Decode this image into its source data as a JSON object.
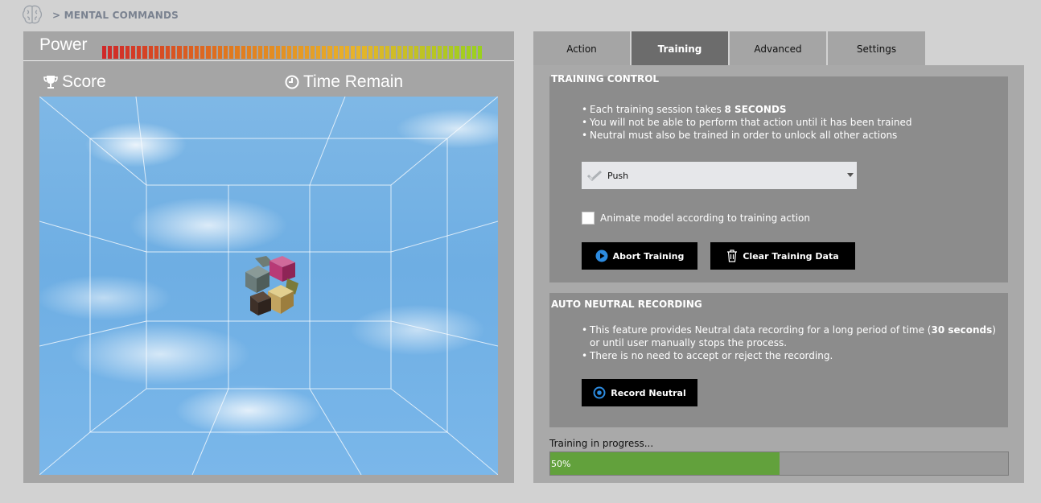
{
  "header": {
    "icon": "brain-icon",
    "breadcrumb": "> MENTAL COMMANDS"
  },
  "left": {
    "power_label": "Power",
    "power_segments": 66,
    "power_colors": [
      "#d02828",
      "#e0781e",
      "#e8b32a",
      "#9ad01e"
    ],
    "score_label": "Score",
    "time_label": "Time Remaining",
    "score_icon": "trophy-icon",
    "time_icon": "clock-icon",
    "stage_object": "cube-icon"
  },
  "tabs": [
    {
      "label": "Action"
    },
    {
      "label": "Training"
    },
    {
      "label": "Advanced"
    },
    {
      "label": "Settings"
    }
  ],
  "training": {
    "title": "TRAINING CONTROL",
    "bullet1_prefix": "Each training session takes ",
    "bullet1_bold": "8 SECONDS",
    "bullet2": "You will not be able to perform that action until it has been trained",
    "bullet3": "Neutral must also be trained in order to unlock all other actions",
    "dropdown_value": "Push",
    "checkbox_label": "Animate model according to training action",
    "abort_label": "Abort Training",
    "clear_label": "Clear Training Data"
  },
  "neutral": {
    "title": "AUTO NEUTRAL RECORDING",
    "bullet1_prefix": "This feature provides Neutral data recording for a long period of time (",
    "bullet1_bold": "30 seconds",
    "bullet1_suffix": ") or until user manually stops the process.",
    "bullet2": "There is no need to accept or reject the recording.",
    "record_label": "Record Neutral"
  },
  "progress": {
    "label": "Training in progress...",
    "value": 50,
    "text": "50%",
    "color": "#62a13c"
  }
}
